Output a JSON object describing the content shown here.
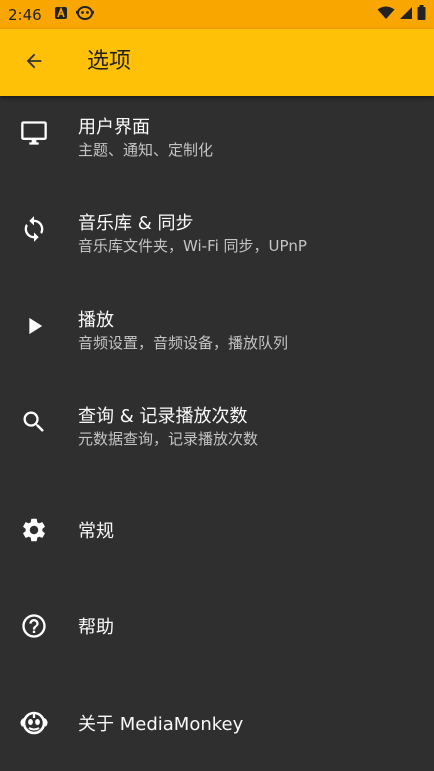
{
  "status_bar": {
    "time": "2:46",
    "icons": [
      "a-badge-icon",
      "monkey-notification-icon",
      "wifi-icon",
      "signal-icon",
      "battery-icon"
    ]
  },
  "app_bar": {
    "back_icon": "arrow-left-icon",
    "title": "选项"
  },
  "colors": {
    "status_bar": "#f9a600",
    "app_bar": "#ffc107",
    "background": "#2f2f2f",
    "title_text": "#fafafa",
    "subtitle_text": "#c4c4c4"
  },
  "menu": [
    {
      "icon": "monitor-icon",
      "title": "用户界面",
      "subtitle": "主题、通知、定制化"
    },
    {
      "icon": "sync-icon",
      "title": "音乐库 & 同步",
      "subtitle": "音乐库文件夹，Wi-Fi 同步，UPnP"
    },
    {
      "icon": "play-icon",
      "title": "播放",
      "subtitle": "音频设置，音频设备，播放队列"
    },
    {
      "icon": "search-icon",
      "title": "查询 & 记录播放次数",
      "subtitle": "元数据查询，记录播放次数"
    },
    {
      "icon": "gear-icon",
      "title": "常规"
    },
    {
      "icon": "help-circle-icon",
      "title": "帮助"
    },
    {
      "icon": "mediamonkey-logo-icon",
      "title": "关于 MediaMonkey"
    }
  ]
}
